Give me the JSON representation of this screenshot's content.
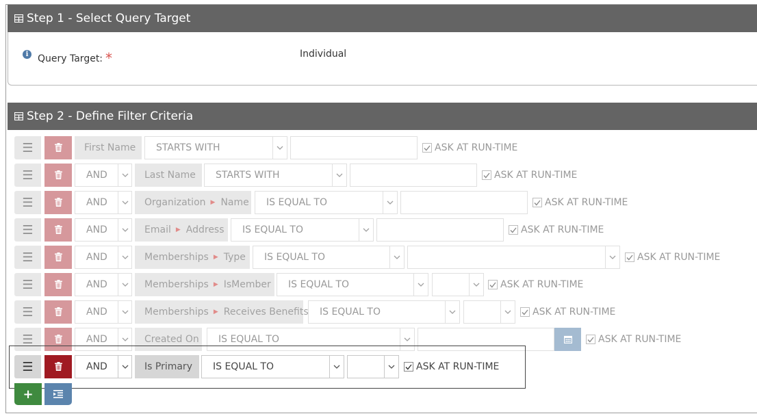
{
  "step1": {
    "title": "Step 1 - Select Query Target",
    "query_target_label": "Query Target:",
    "required_mark": "*",
    "query_target_value": "Individual"
  },
  "step2": {
    "title": "Step 2 - Define Filter Criteria"
  },
  "ask_label": "ASK AT RUN-TIME",
  "icons": {
    "panel": "table-icon",
    "info": "info-icon",
    "drag": "hamburger-icon",
    "delete": "trash-icon",
    "caret": "chevron-down-icon",
    "calendar": "calendar-icon",
    "add": "plus-icon",
    "indent": "indent-icon"
  },
  "colors": {
    "header_bg": "#646464",
    "delete_bg": "#b6454d",
    "delete_active_bg": "#a01a22",
    "add_bg": "#3f8a3f",
    "blue_bg": "#5b84ad",
    "field_bg": "#d6d6d6"
  },
  "rows": [
    {
      "logic": "",
      "field": [
        "First Name"
      ],
      "operator": "STARTS WITH",
      "value": "",
      "ask": true
    },
    {
      "logic": "AND",
      "field": [
        "Last Name"
      ],
      "operator": "STARTS WITH",
      "value": "",
      "ask": true
    },
    {
      "logic": "AND",
      "field": [
        "Organization",
        "Name"
      ],
      "operator": "IS EQUAL TO",
      "value": "",
      "ask": true
    },
    {
      "logic": "AND",
      "field": [
        "Email",
        "Address"
      ],
      "operator": "IS EQUAL TO",
      "value": "",
      "ask": true
    },
    {
      "logic": "AND",
      "field": [
        "Memberships",
        "Type"
      ],
      "operator": "IS EQUAL TO",
      "value": "",
      "ask": true
    },
    {
      "logic": "AND",
      "field": [
        "Memberships",
        "IsMember"
      ],
      "operator": "IS EQUAL TO",
      "value": "",
      "ask": true
    },
    {
      "logic": "AND",
      "field": [
        "Memberships",
        "Receives Benefits"
      ],
      "operator": "IS EQUAL TO",
      "value": "",
      "ask": true
    },
    {
      "logic": "AND",
      "field": [
        "Created On"
      ],
      "operator": "IS EQUAL TO",
      "value": "",
      "ask": true
    },
    {
      "logic": "AND",
      "field": [
        "Is Primary"
      ],
      "operator": "IS EQUAL TO",
      "value": "",
      "ask": true
    }
  ]
}
